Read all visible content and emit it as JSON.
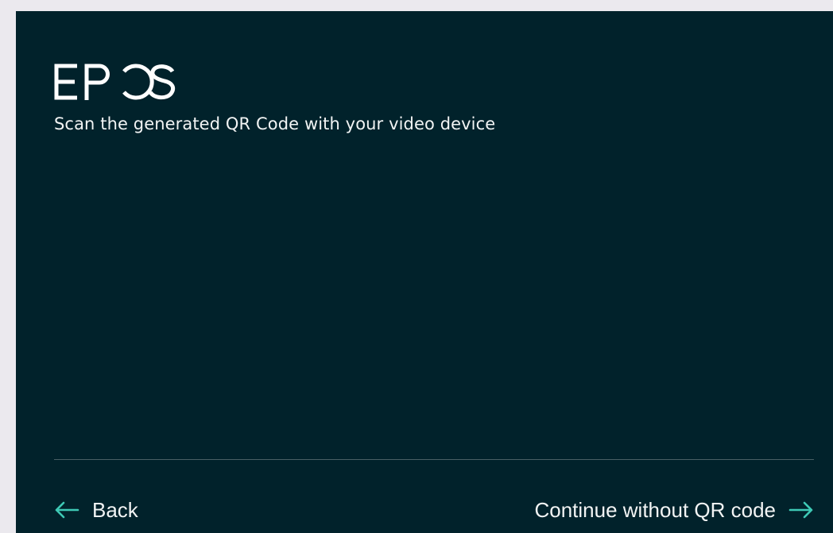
{
  "brand": {
    "logo_text": "EPOS",
    "accent_color": "#3ec9b5",
    "background_color": "#01222b"
  },
  "main": {
    "instruction": "Scan the generated QR Code with your video device"
  },
  "footer": {
    "back_label": "Back",
    "back_icon": "arrow-left-icon",
    "continue_label": "Continue without QR code",
    "continue_icon": "arrow-right-icon"
  }
}
